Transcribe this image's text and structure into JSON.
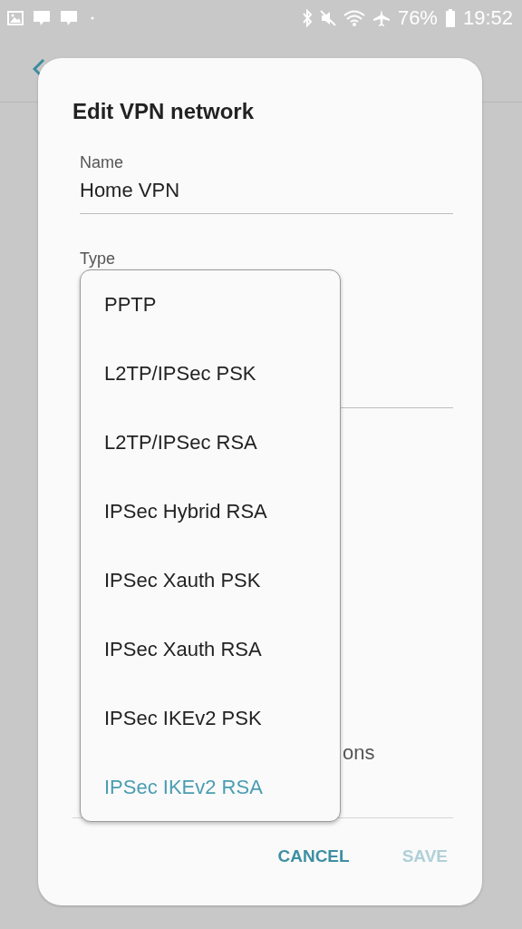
{
  "status_bar": {
    "battery": "76%",
    "time": "19:52"
  },
  "dialog": {
    "title": "Edit VPN network",
    "fields": [
      {
        "kind": "text",
        "label": "Name",
        "value": "Home VPN"
      },
      {
        "kind": "select",
        "label": "Type"
      }
    ],
    "partial_text": "ons",
    "buttons": [
      {
        "label": "CANCEL",
        "disabled": false
      },
      {
        "label": "SAVE",
        "disabled": true
      }
    ]
  },
  "type_menu": {
    "items": [
      {
        "label": "PPTP",
        "selected": false
      },
      {
        "label": "L2TP/IPSec PSK",
        "selected": false
      },
      {
        "label": "L2TP/IPSec RSA",
        "selected": false
      },
      {
        "label": "IPSec Hybrid RSA",
        "selected": false
      },
      {
        "label": "IPSec Xauth PSK",
        "selected": false
      },
      {
        "label": "IPSec Xauth RSA",
        "selected": false
      },
      {
        "label": "IPSec IKEv2 PSK",
        "selected": false
      },
      {
        "label": "IPSec IKEv2 RSA",
        "selected": true
      }
    ]
  }
}
